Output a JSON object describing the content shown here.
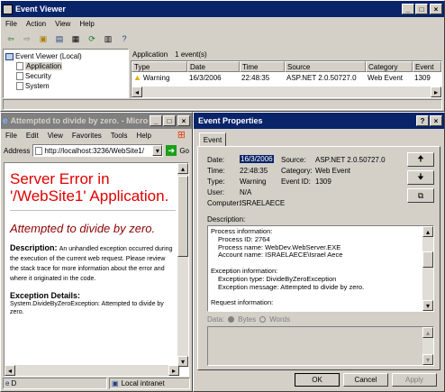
{
  "event_viewer": {
    "title": "Event Viewer",
    "menu": [
      "File",
      "Action",
      "View",
      "Help"
    ],
    "tree": [
      "Event Viewer (Local)",
      "Application",
      "Security",
      "System"
    ],
    "list_title": "Application",
    "list_count": "1 event(s)",
    "columns": [
      "Type",
      "Date",
      "Time",
      "Source",
      "Category",
      "Event"
    ],
    "rows": [
      {
        "type": "Warning",
        "date": "16/3/2006",
        "time": "22:48:35",
        "source": "ASP.NET 2.0.50727.0",
        "category": "Web Event",
        "event": "1309"
      }
    ]
  },
  "browser": {
    "title": "Attempted to divide by zero. - Micros...",
    "menu": [
      "File",
      "Edit",
      "View",
      "Favorites",
      "Tools",
      "Help"
    ],
    "address_label": "Address",
    "address_value": "http://localhost:3236/WebSite1/",
    "go_label": "Go",
    "error_heading": "Server Error in '/WebSite1' Application.",
    "error_subheading": "Attempted to divide by zero.",
    "description_label": "Description:",
    "description_text": "An unhandled exception occurred during the execution of the current web request. Please review the stack trace for more information about the error and where it originated in the code.",
    "exception_label": "Exception Details:",
    "exception_text": "System.DivideByZeroException: Attempted to divide by zero.",
    "status_left": "D",
    "status_zone": "Local intranet"
  },
  "props": {
    "title": "Event Properties",
    "tab": "Event",
    "date_label": "Date:",
    "date_value": "16/3/2006",
    "source_label": "Source:",
    "source_value": "ASP.NET 2.0.50727.0",
    "time_label": "Time:",
    "time_value": "22:48:35",
    "category_label": "Category:",
    "category_value": "Web Event",
    "type_label": "Type:",
    "type_value": "Warning",
    "eventid_label": "Event ID:",
    "eventid_value": "1309",
    "user_label": "User:",
    "user_value": "N/A",
    "computer_label": "Computer:",
    "computer_value": "ISRAELAECE",
    "description_label": "Description:",
    "description_lines": [
      "Process information:",
      "    Process ID: 2764",
      "    Process name: WebDev.WebServer.EXE",
      "    Account name: ISRAELAECE\\Israel Aece",
      "",
      "Exception information:",
      "    Exception type: DivideByZeroException",
      "    Exception message: Attempted to divide by zero.",
      "",
      "Request information:"
    ],
    "data_label": "Data:",
    "bytes_label": "Bytes",
    "words_label": "Words",
    "ok": "OK",
    "cancel": "Cancel",
    "apply": "Apply"
  }
}
